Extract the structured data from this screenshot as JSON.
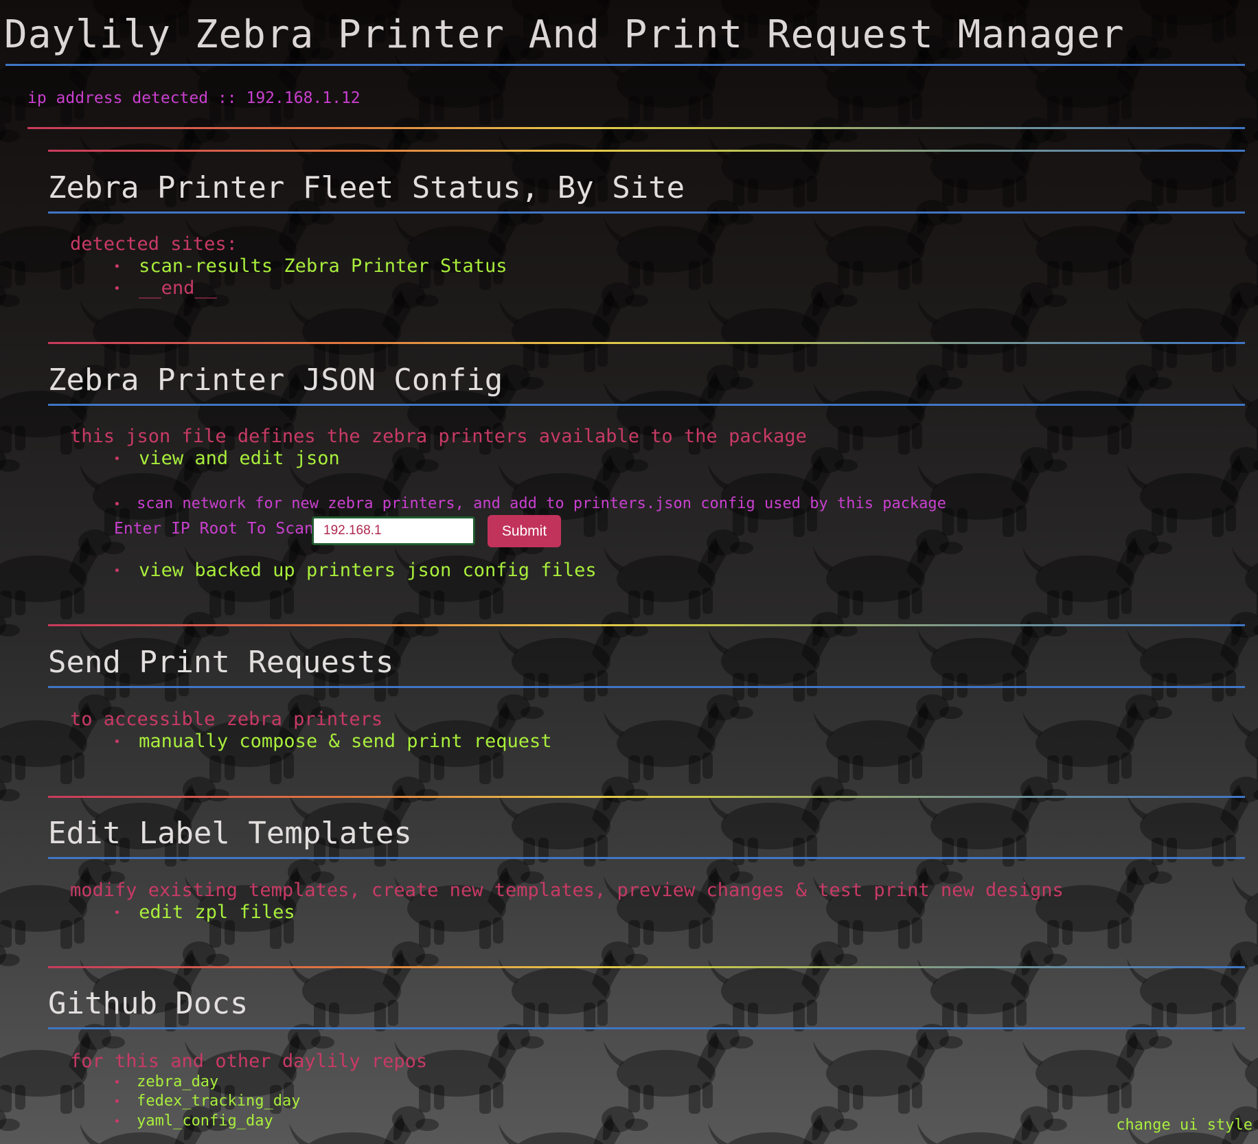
{
  "header": {
    "title": "Daylily Zebra Printer And Print Request Manager",
    "ip_text": "ip address detected :: 192.168.1.12"
  },
  "fleet": {
    "title": "Zebra Printer Fleet Status, By Site",
    "desc": "detected sites:",
    "items": [
      {
        "label": "scan-results Zebra Printer Status"
      },
      {
        "label": "__end__"
      }
    ]
  },
  "config": {
    "title": "Zebra Printer JSON Config",
    "desc": "this json file defines the zebra printers available to the package",
    "view_edit_label": "view and edit json",
    "scan_text": "scan network for new zebra printers, and add to printers.json config used by this package",
    "scan_label": "Enter IP Root To Scan:",
    "scan_input_value": "192.168.1",
    "submit_label": "Submit",
    "backup_label": "view backed up printers json config files"
  },
  "print": {
    "title": "Send Print Requests",
    "desc": "to accessible zebra printers",
    "link_label": "manually compose & send print request"
  },
  "templates": {
    "title": "Edit Label Templates",
    "desc": "modify existing templates, create new templates, preview changes & test print new designs",
    "link_label": "edit zpl files"
  },
  "docs": {
    "title": "Github Docs",
    "desc": "for this and other daylily repos",
    "links": [
      {
        "label": "zebra_day"
      },
      {
        "label": "fedex_tracking_day"
      },
      {
        "label": "yaml_config_day"
      }
    ]
  },
  "footer": {
    "change_style_label": "change ui style"
  },
  "colors": {
    "accent_blue": "#3f76c4",
    "link_green": "#a9ef3c",
    "desc_red": "#c83a66",
    "magenta": "#c940cf",
    "button": "#c2335c"
  }
}
